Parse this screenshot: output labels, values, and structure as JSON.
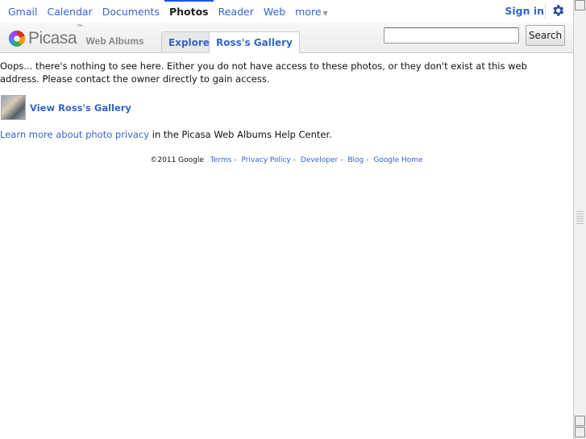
{
  "gbar": {
    "nav": [
      "Gmail",
      "Calendar",
      "Documents",
      "Photos",
      "Reader",
      "Web",
      "more"
    ],
    "active": "Photos",
    "signin": "Sign in",
    "accent": "#1a54e5",
    "link_color": "#3366cc",
    "settings_icon": "gear-icon"
  },
  "header": {
    "brand": "Picasa",
    "tm": "™",
    "subtitle": "Web Albums",
    "tabs": [
      {
        "label": "Explore"
      },
      {
        "label": "Ross's Gallery",
        "selected": true
      }
    ],
    "search": {
      "value": "",
      "button": "Search"
    }
  },
  "main": {
    "message": "Oops... there's nothing to see here. Either you do not have access to these photos, or they don't exist at this web address. Please contact the owner directly to gain access.",
    "gallery_link": "View Ross's Gallery",
    "privacy_link": "Learn more about photo privacy",
    "privacy_suffix": " in the Picasa Web Albums Help Center."
  },
  "footer": {
    "copyright": "©2011 Google",
    "links": [
      "Terms",
      "Privacy Policy",
      "Developer",
      "Blog",
      "Google Home"
    ]
  }
}
